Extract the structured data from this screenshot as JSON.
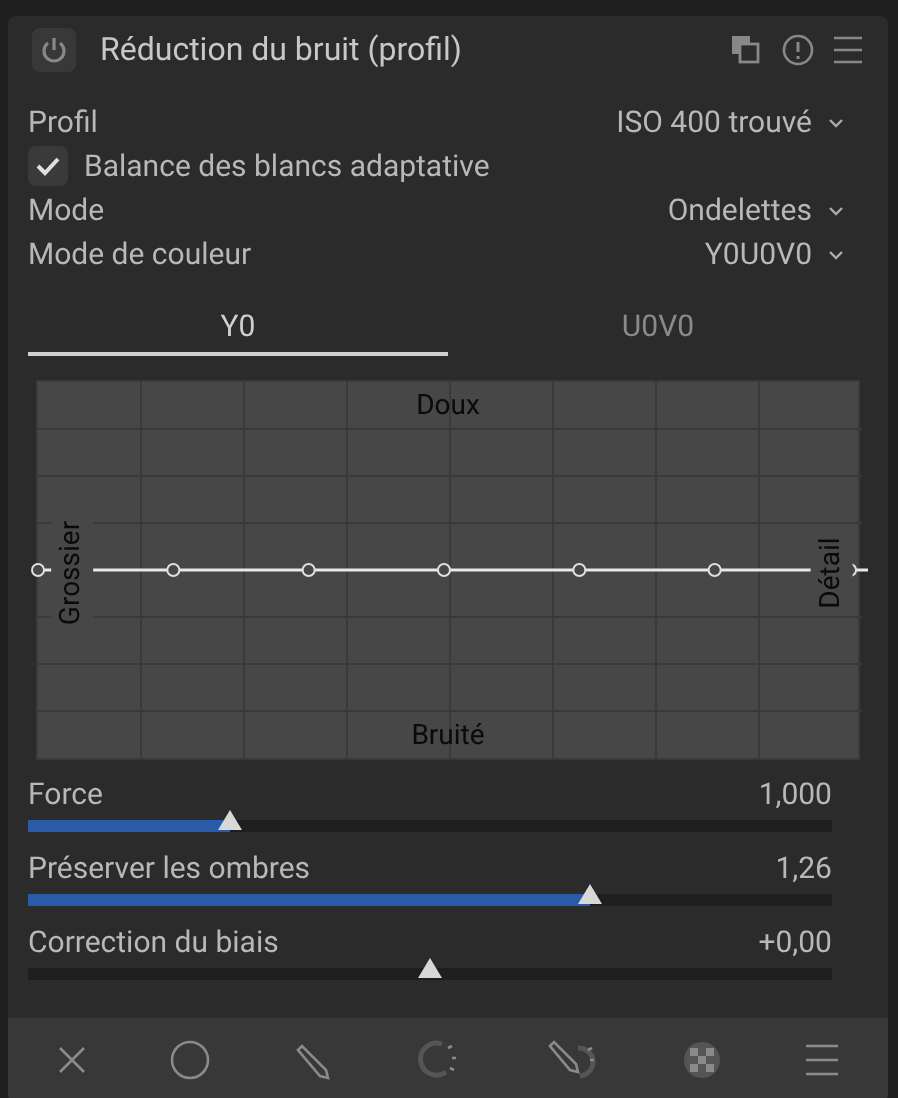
{
  "module": {
    "title": "Réduction du bruit (profil)",
    "enabled": false
  },
  "rows": [
    {
      "kind": "combo",
      "label": "Profil",
      "value": "ISO 400 trouvé"
    },
    {
      "kind": "checkbox",
      "label": "Balance des blancs adaptative",
      "checked": true
    },
    {
      "kind": "combo",
      "label": "Mode",
      "value": "Ondelettes"
    },
    {
      "kind": "combo",
      "label": "Mode de couleur",
      "value": "Y0U0V0"
    }
  ],
  "tabs": [
    {
      "label": "Y0",
      "selected": true
    },
    {
      "label": "U0V0",
      "selected": false
    }
  ],
  "graph": {
    "top_label": "Doux",
    "bottom_label": "Bruité",
    "left_label": "Grossier",
    "right_label": "Détail"
  },
  "sliders": [
    {
      "kind": "normal",
      "label": "Force",
      "value": "1,000",
      "level": 0.25
    },
    {
      "kind": "normal",
      "label": "Préserver les ombres",
      "value": "1,26",
      "level": 0.7
    },
    {
      "kind": "centered",
      "label": "Correction du biais",
      "value": "+0,00",
      "level": 0.5
    }
  ]
}
